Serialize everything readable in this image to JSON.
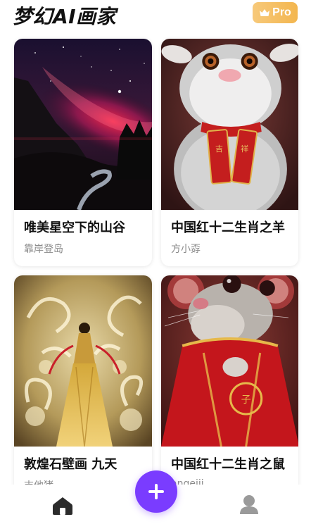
{
  "header": {
    "app_title": "梦幻AI画家",
    "pro_label": "Pro",
    "pro_icon": "crown-icon"
  },
  "cards": [
    {
      "title": "唯美星空下的山谷",
      "author": "靠岸登岛",
      "image": "starry-valley-painting"
    },
    {
      "title": "中国红十二生肖之羊",
      "author": "方小孬",
      "image": "zodiac-sheep-painting"
    },
    {
      "title": "敦煌石壁画 九天",
      "author": "吉他猪",
      "image": "dunhuang-mural-painting"
    },
    {
      "title": "中国红十二生肖之鼠",
      "author": "angeiji",
      "image": "zodiac-rat-painting"
    }
  ],
  "bottom_nav": {
    "home_icon": "home-icon",
    "create_icon": "plus-icon",
    "profile_icon": "user-icon"
  },
  "colors": {
    "accent": "#7a3cff",
    "pro_badge": "#f3b64f",
    "author_text": "#8a8a8a",
    "nav_home": "#2b2b2b",
    "nav_profile": "#9a9a9a"
  }
}
